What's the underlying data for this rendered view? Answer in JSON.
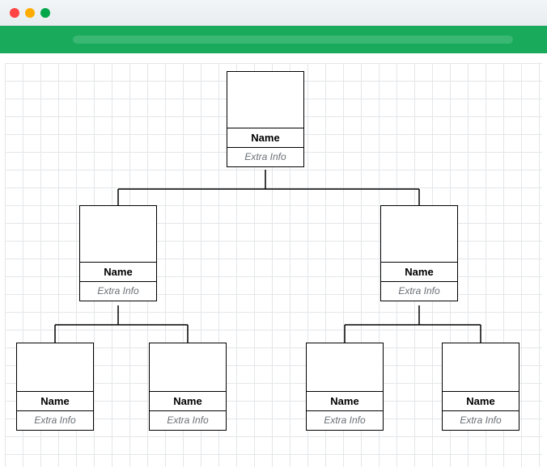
{
  "window": {
    "traffic_lights": [
      "close",
      "minimize",
      "zoom"
    ]
  },
  "toolbar": {
    "accent_color": "#19aa5b"
  },
  "org_chart": {
    "root": {
      "name": "Name",
      "extra": "Extra Info",
      "children": [
        {
          "name": "Name",
          "extra": "Extra Info",
          "children": [
            {
              "name": "Name",
              "extra": "Extra Info"
            },
            {
              "name": "Name",
              "extra": "Extra Info"
            }
          ]
        },
        {
          "name": "Name",
          "extra": "Extra Info",
          "children": [
            {
              "name": "Name",
              "extra": "Extra Info"
            },
            {
              "name": "Name",
              "extra": "Extra Info"
            }
          ]
        }
      ]
    }
  }
}
